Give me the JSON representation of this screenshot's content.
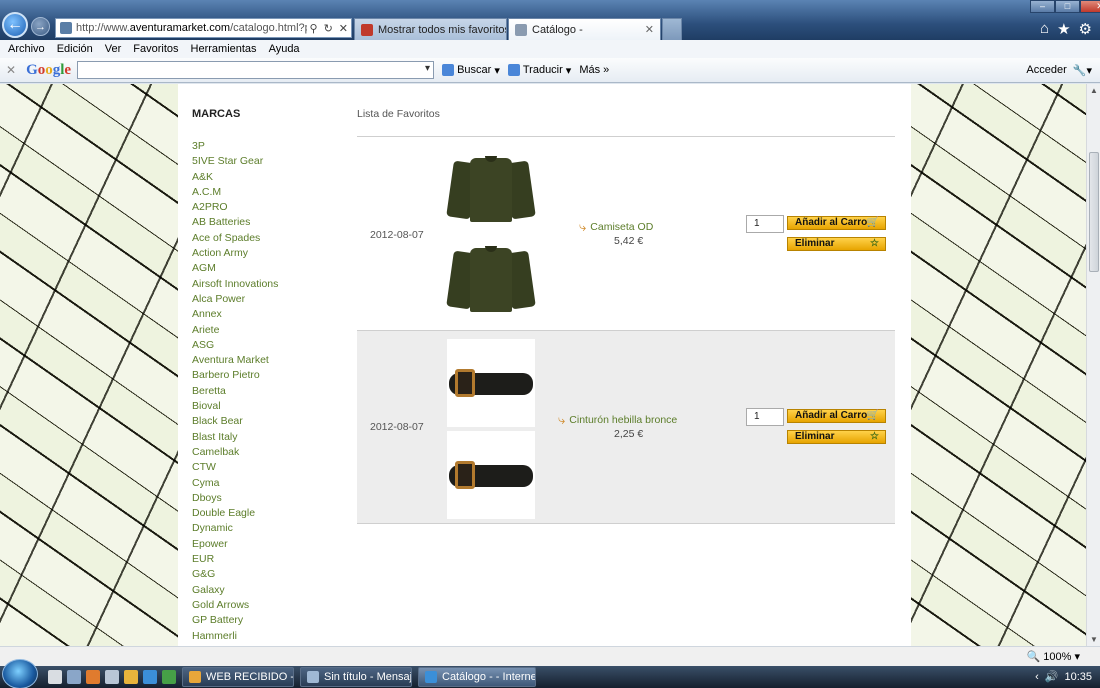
{
  "browser": {
    "address_url_prefix": "http://www.",
    "address_url_domain": "aventuramarket.com",
    "address_url_suffix": "/catalogo.html?page=",
    "tabs": [
      {
        "label": "Mostrar todos mis favoritos - ...",
        "icon_color": "#c0392b"
      },
      {
        "label": "Catálogo -",
        "icon_color": "#8a9bb0"
      }
    ],
    "menu": [
      "Archivo",
      "Edición",
      "Ver",
      "Favoritos",
      "Herramientas",
      "Ayuda"
    ],
    "google_logo": "Google",
    "google_search_label": "Buscar",
    "google_translate_label": "Traducir",
    "google_more_label": "Más",
    "google_signin_label": "Acceder",
    "zoom_level": "100%"
  },
  "sidebar": {
    "title": "MARCAS",
    "brands": [
      "3P",
      "5IVE Star Gear",
      "A&K",
      "A.C.M",
      "A2PRO",
      "AB Batteries",
      "Ace of Spades",
      "Action Army",
      "AGM",
      "Airsoft Innovations",
      "Alca Power",
      "Annex",
      "Ariete",
      "ASG",
      "Aventura Market",
      "Barbero Pietro",
      "Beretta",
      "Bioval",
      "Black Bear",
      "Blast Italy",
      "Camelbak",
      "CTW",
      "Cyma",
      "Dboys",
      "Double Eagle",
      "Dynamic",
      "Epower",
      "EUR",
      "G&G",
      "Galaxy",
      "Gold Arrows",
      "GP Battery",
      "Hammerli"
    ]
  },
  "favorites": {
    "title": "Lista de Favoritos",
    "add_to_cart_label": "Añadir al Carro",
    "remove_label": "Eliminar",
    "items": [
      {
        "date": "2012-08-07",
        "name": "Camiseta OD",
        "price": "5,42 €",
        "quantity": "1",
        "image": "olive-long-sleeve-shirt"
      },
      {
        "date": "2012-08-07",
        "name": "Cinturón hebilla bronce",
        "price": "2,25 €",
        "quantity": "1",
        "image": "black-belt-bronze-buckle"
      }
    ]
  },
  "taskbar": {
    "items": [
      {
        "label": "WEB RECIBIDO - Mi...",
        "icon_color": "#e8a63a",
        "active": false
      },
      {
        "label": "Sin título - Mensaje ...",
        "icon_color": "#9fb8d4",
        "active": false
      },
      {
        "label": "Catálogo - - Interne...",
        "icon_color": "#3b8fd8",
        "active": true
      }
    ],
    "clock": "10:35"
  },
  "colors": {
    "link_green": "#5c7d2a",
    "button_yellow": "#f2bc1c",
    "row_alt_bg": "#ededed"
  }
}
